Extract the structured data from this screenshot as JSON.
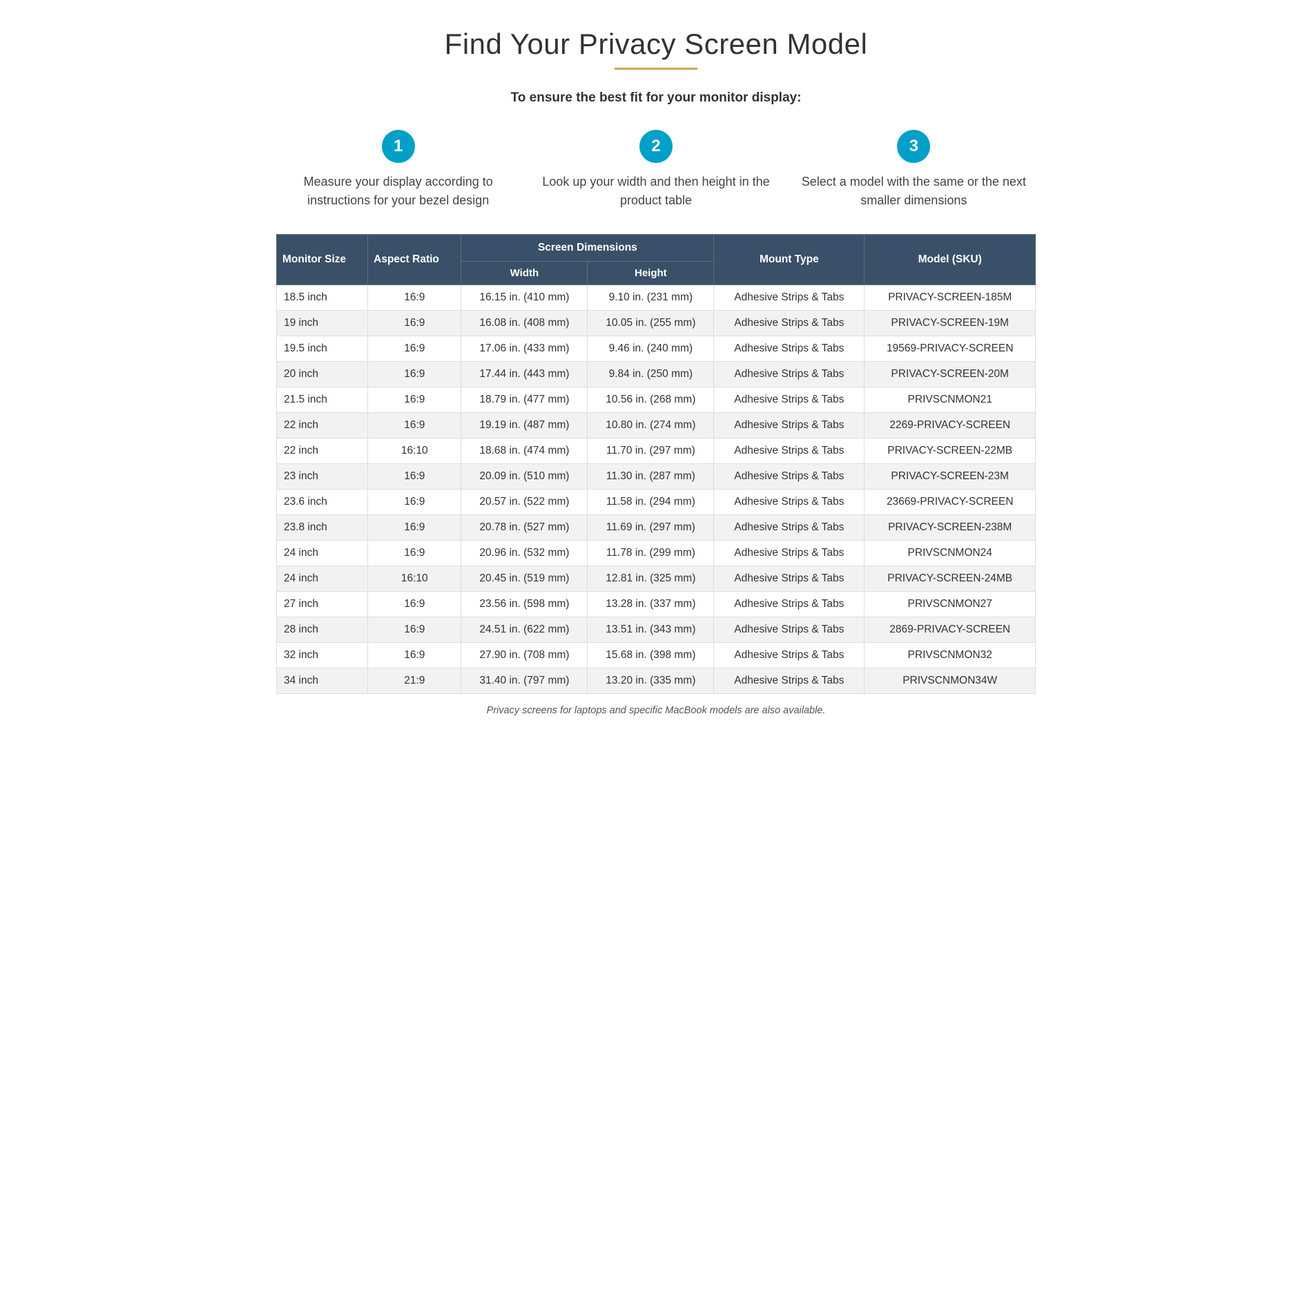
{
  "title": "Find Your Privacy Screen Model",
  "subtitle": "To ensure the best fit for your monitor display:",
  "gold_divider": true,
  "steps": [
    {
      "number": "1",
      "text": "Measure your display according to instructions for your bezel design"
    },
    {
      "number": "2",
      "text": "Look up your width and then height in the product table"
    },
    {
      "number": "3",
      "text": "Select a model with the same or the next smaller dimensions"
    }
  ],
  "table": {
    "col_headers": {
      "monitor_size": "Monitor Size",
      "aspect_ratio": "Aspect Ratio",
      "screen_dimensions": "Screen Dimensions",
      "width": "Width",
      "height": "Height",
      "mount_type": "Mount Type",
      "model_sku": "Model (SKU)"
    },
    "rows": [
      {
        "monitor_size": "18.5 inch",
        "aspect_ratio": "16:9",
        "width": "16.15 in. (410 mm)",
        "height": "9.10 in. (231 mm)",
        "mount_type": "Adhesive Strips & Tabs",
        "model_sku": "PRIVACY-SCREEN-185M"
      },
      {
        "monitor_size": "19 inch",
        "aspect_ratio": "16:9",
        "width": "16.08 in. (408 mm)",
        "height": "10.05 in. (255 mm)",
        "mount_type": "Adhesive Strips & Tabs",
        "model_sku": "PRIVACY-SCREEN-19M"
      },
      {
        "monitor_size": "19.5 inch",
        "aspect_ratio": "16:9",
        "width": "17.06 in. (433 mm)",
        "height": "9.46 in. (240 mm)",
        "mount_type": "Adhesive Strips & Tabs",
        "model_sku": "19569-PRIVACY-SCREEN"
      },
      {
        "monitor_size": "20 inch",
        "aspect_ratio": "16:9",
        "width": "17.44 in. (443 mm)",
        "height": "9.84 in. (250 mm)",
        "mount_type": "Adhesive Strips & Tabs",
        "model_sku": "PRIVACY-SCREEN-20M"
      },
      {
        "monitor_size": "21.5 inch",
        "aspect_ratio": "16:9",
        "width": "18.79 in. (477 mm)",
        "height": "10.56 in. (268 mm)",
        "mount_type": "Adhesive Strips & Tabs",
        "model_sku": "PRIVSCNMON21"
      },
      {
        "monitor_size": "22 inch",
        "aspect_ratio": "16:9",
        "width": "19.19 in. (487 mm)",
        "height": "10.80 in. (274 mm)",
        "mount_type": "Adhesive Strips & Tabs",
        "model_sku": "2269-PRIVACY-SCREEN"
      },
      {
        "monitor_size": "22 inch",
        "aspect_ratio": "16:10",
        "width": "18.68 in. (474 mm)",
        "height": "11.70 in. (297 mm)",
        "mount_type": "Adhesive Strips & Tabs",
        "model_sku": "PRIVACY-SCREEN-22MB"
      },
      {
        "monitor_size": "23 inch",
        "aspect_ratio": "16:9",
        "width": "20.09 in. (510 mm)",
        "height": "11.30 in. (287 mm)",
        "mount_type": "Adhesive Strips & Tabs",
        "model_sku": "PRIVACY-SCREEN-23M"
      },
      {
        "monitor_size": "23.6 inch",
        "aspect_ratio": "16:9",
        "width": "20.57 in. (522 mm)",
        "height": "11.58 in. (294 mm)",
        "mount_type": "Adhesive Strips & Tabs",
        "model_sku": "23669-PRIVACY-SCREEN"
      },
      {
        "monitor_size": "23.8 inch",
        "aspect_ratio": "16:9",
        "width": "20.78 in. (527 mm)",
        "height": "11.69 in. (297 mm)",
        "mount_type": "Adhesive Strips & Tabs",
        "model_sku": "PRIVACY-SCREEN-238M"
      },
      {
        "monitor_size": "24 inch",
        "aspect_ratio": "16:9",
        "width": "20.96 in. (532 mm)",
        "height": "11.78 in. (299 mm)",
        "mount_type": "Adhesive Strips & Tabs",
        "model_sku": "PRIVSCNMON24"
      },
      {
        "monitor_size": "24 inch",
        "aspect_ratio": "16:10",
        "width": "20.45 in. (519 mm)",
        "height": "12.81 in. (325 mm)",
        "mount_type": "Adhesive Strips & Tabs",
        "model_sku": "PRIVACY-SCREEN-24MB"
      },
      {
        "monitor_size": "27 inch",
        "aspect_ratio": "16:9",
        "width": "23.56 in. (598 mm)",
        "height": "13.28 in. (337 mm)",
        "mount_type": "Adhesive Strips & Tabs",
        "model_sku": "PRIVSCNMON27"
      },
      {
        "monitor_size": "28 inch",
        "aspect_ratio": "16:9",
        "width": "24.51 in. (622 mm)",
        "height": "13.51 in. (343 mm)",
        "mount_type": "Adhesive Strips & Tabs",
        "model_sku": "2869-PRIVACY-SCREEN"
      },
      {
        "monitor_size": "32 inch",
        "aspect_ratio": "16:9",
        "width": "27.90 in. (708 mm)",
        "height": "15.68 in. (398 mm)",
        "mount_type": "Adhesive Strips & Tabs",
        "model_sku": "PRIVSCNMON32"
      },
      {
        "monitor_size": "34 inch",
        "aspect_ratio": "21:9",
        "width": "31.40 in. (797 mm)",
        "height": "13.20 in. (335 mm)",
        "mount_type": "Adhesive Strips & Tabs",
        "model_sku": "PRIVSCNMON34W"
      }
    ]
  },
  "footer_note": "Privacy screens for laptops and specific MacBook models are also available."
}
